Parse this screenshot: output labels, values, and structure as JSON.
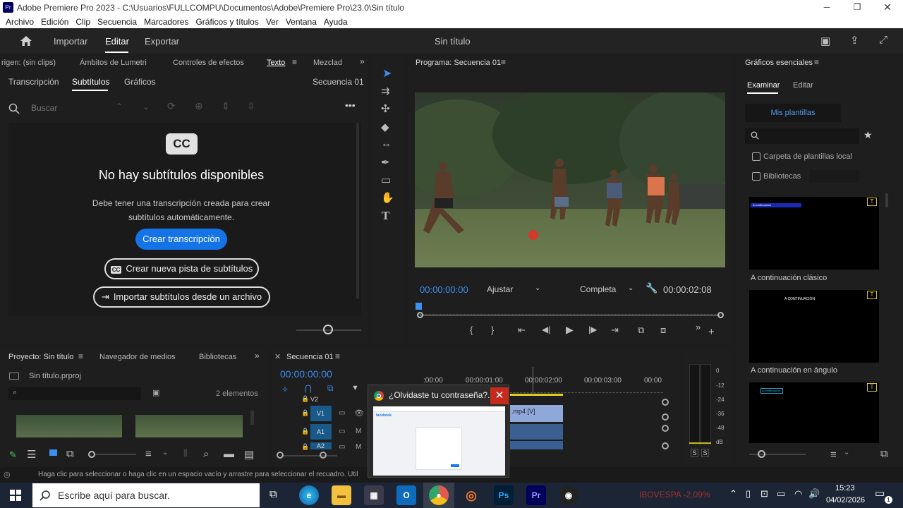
{
  "window": {
    "title": "Adobe Premiere Pro 2023 - C:\\Usuarios\\FULLCOMPU\\Documentos\\Adobe\\Premiere Pro\\23.0\\Sin título",
    "app_badge": "Pr"
  },
  "menu": [
    "Archivo",
    "Edición",
    "Clip",
    "Secuencia",
    "Marcadores",
    "Gráficos y títulos",
    "Ver",
    "Ventana",
    "Ayuda"
  ],
  "header": {
    "tabs": [
      "Importar",
      "Editar",
      "Exportar"
    ],
    "active": "Editar",
    "project_title": "Sin título"
  },
  "left_tabs": [
    "rigen: (sin clips)",
    "Ámbitos de Lumetri",
    "Controles de efectos",
    "Texto",
    "Mezclad"
  ],
  "text_panel": {
    "subtabs": [
      "Transcripción",
      "Subtítulos",
      "Gráficos"
    ],
    "active_subtab": "Subtítulos",
    "sequence": "Secuencia 01",
    "search_placeholder": "Buscar",
    "cc_badge": "CC",
    "heading": "No hay subtítulos disponibles",
    "message": "Debe tener una transcripción creada para crear subtítulos automáticamente.",
    "btn_create": "Crear transcripción",
    "btn_new_track": "Crear nueva pista de subtítulos",
    "btn_import": "Importar subtítulos desde un archivo"
  },
  "program": {
    "title": "Programa: Secuencia 01",
    "timecode": "00:00:00:00",
    "fit": "Ajustar",
    "quality": "Completa",
    "duration": "00:00:02:08"
  },
  "essential": {
    "title": "Gráficos esenciales",
    "tabs": [
      "Examinar",
      "Editar"
    ],
    "my_templates": "Mis plantillas",
    "local_folder": "Carpeta de plantillas local",
    "libraries": "Bibliotecas",
    "templates": [
      {
        "name": "A continuación clásico",
        "thumb": "A continuación"
      },
      {
        "name": "A continuación en ángulo",
        "thumb": "A CONTINUACIÓN"
      },
      {
        "name": "",
        "thumb": "A continuación"
      }
    ]
  },
  "project": {
    "tabs": [
      "Proyecto: Sin título",
      "Navegador de medios",
      "Bibliotecas"
    ],
    "file": "Sin título.prproj",
    "count": "2 elementos"
  },
  "timeline": {
    "title": "Secuencia 01",
    "timecode": "00:00:00:00",
    "ruler": [
      ":00:00",
      "00:00:01:00",
      "00:00:02:00",
      "00:00:03:00",
      "00:00"
    ],
    "tracks": [
      "V2",
      "V1",
      "A1",
      "A2"
    ],
    "clip": ".mp4 [V]"
  },
  "meter": {
    "scale": [
      "0",
      "-12",
      "-24",
      "-36",
      "-48",
      "dB"
    ],
    "solo": "S"
  },
  "popup": {
    "title": "¿Olvidaste tu contraseña?...",
    "site": "facebook"
  },
  "status": "Haga clic para seleccionar o haga clic en un espacio vacío y arrastre para seleccionar el recuadro. Util",
  "taskbar": {
    "search_placeholder": "Escribe aquí para buscar.",
    "ticker": "IBOVESPA  -2,09%",
    "time": "15:23",
    "date": "04/02/2026",
    "notification_count": "1"
  },
  "colors": {
    "accent": "#1473e6",
    "pr_purple": "#2f1f6b",
    "pr_text": "#9999ff"
  }
}
